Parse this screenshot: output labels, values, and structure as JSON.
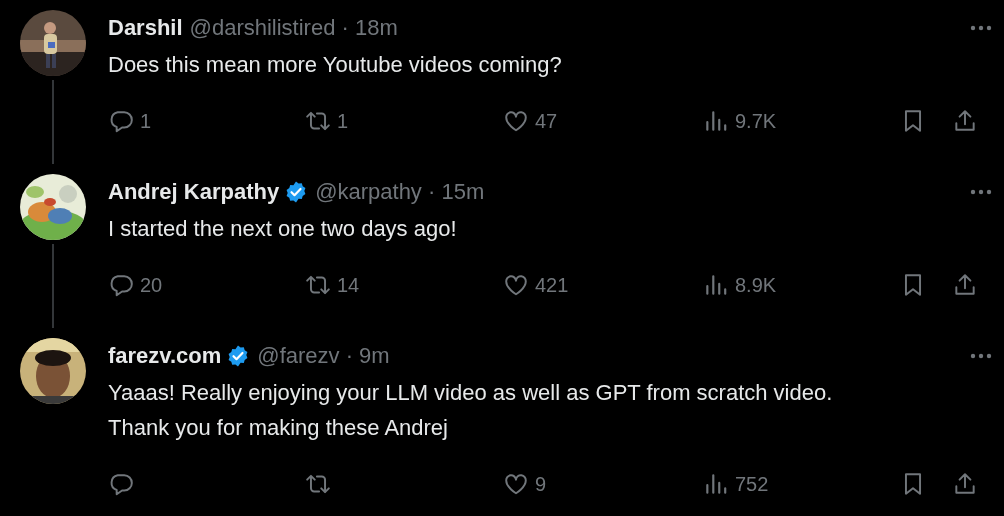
{
  "tweets": [
    {
      "name": "Darshil",
      "verified": false,
      "meta": "@darshilistired · 18m",
      "text": "Does this mean more Youtube videos coming?",
      "stats": {
        "replies": "1",
        "reposts": "1",
        "likes": "47",
        "views": "9.7K"
      }
    },
    {
      "name": "Andrej Karpathy",
      "verified": true,
      "meta": "@karpathy · 15m",
      "text": "I started the next one two days ago!",
      "stats": {
        "replies": "20",
        "reposts": "14",
        "likes": "421",
        "views": "8.9K"
      }
    },
    {
      "name": "farezv.com",
      "verified": true,
      "meta": "@farezv · 9m",
      "text": "Yaaas! Really enjoying your LLM video as well as GPT from scratch video.\nThank you for making these Andrej",
      "stats": {
        "likes": "9",
        "views": "752"
      }
    }
  ]
}
